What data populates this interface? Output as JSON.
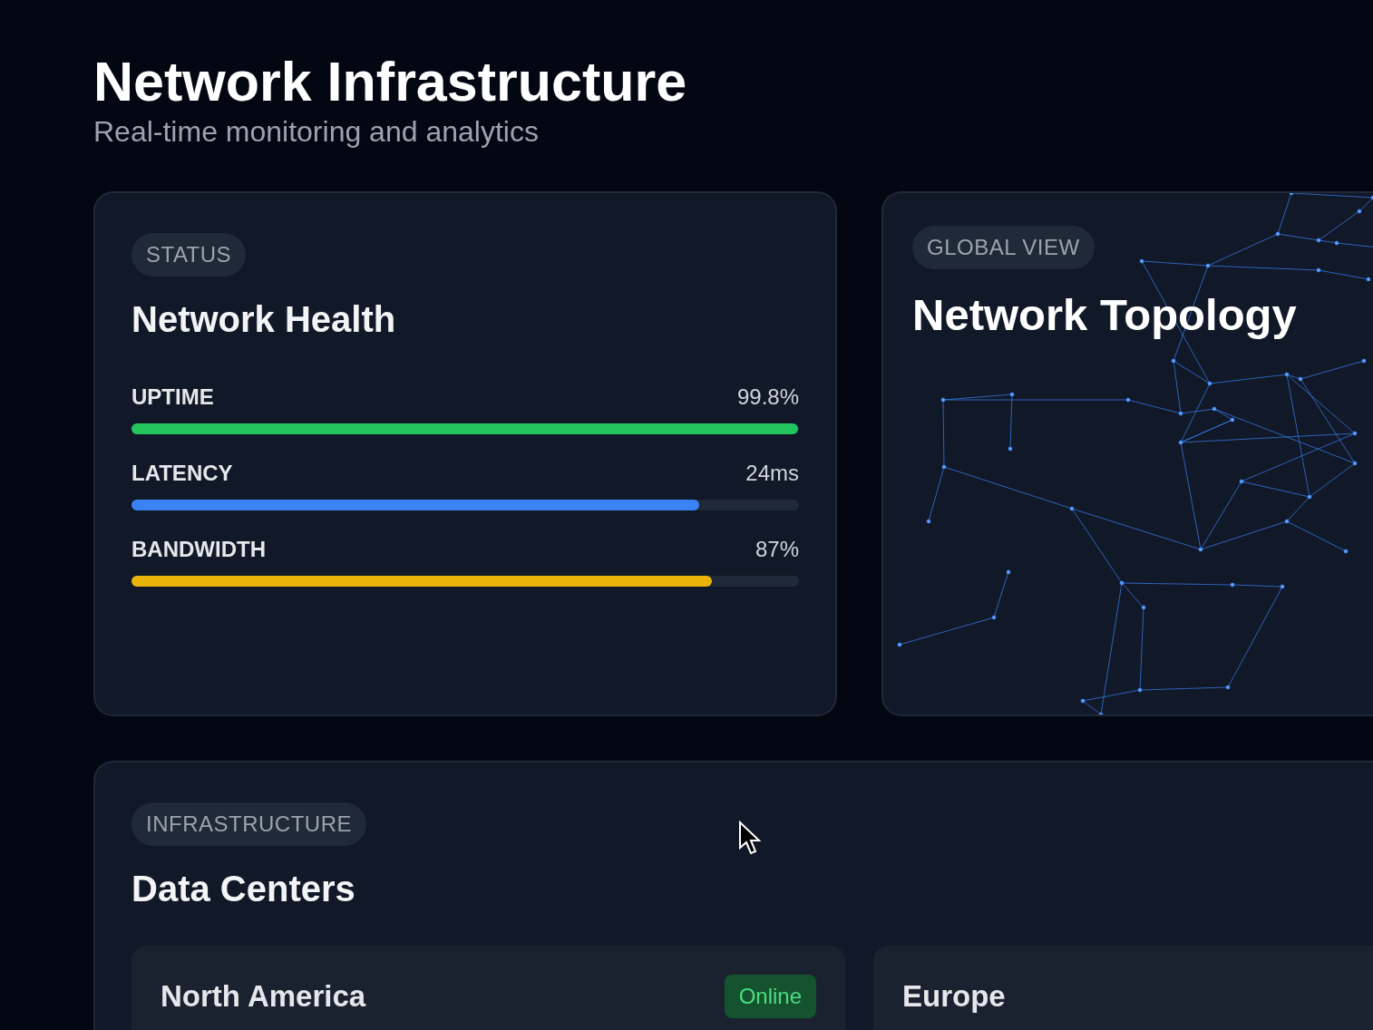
{
  "header": {
    "title": "Network Infrastructure",
    "subtitle": "Real-time monitoring and analytics"
  },
  "health": {
    "tag": "STATUS",
    "title": "Network Health",
    "metrics": [
      {
        "label": "UPTIME",
        "reading": "99.8%",
        "level": 0.998,
        "color": "#22c55e"
      },
      {
        "label": "LATENCY",
        "reading": "24ms",
        "level": 0.85,
        "color": "#3b82f6"
      },
      {
        "label": "BANDWIDTH",
        "reading": "87%",
        "level": 0.87,
        "color": "#eab308"
      }
    ]
  },
  "topology": {
    "tag": "GLOBAL VIEW",
    "title": "Network Topology"
  },
  "datacenters": {
    "tag": "INFRASTRUCTURE",
    "title": "Data Centers",
    "regions": [
      {
        "name": "North America",
        "status": "Online"
      },
      {
        "name": "Europe"
      }
    ]
  }
}
